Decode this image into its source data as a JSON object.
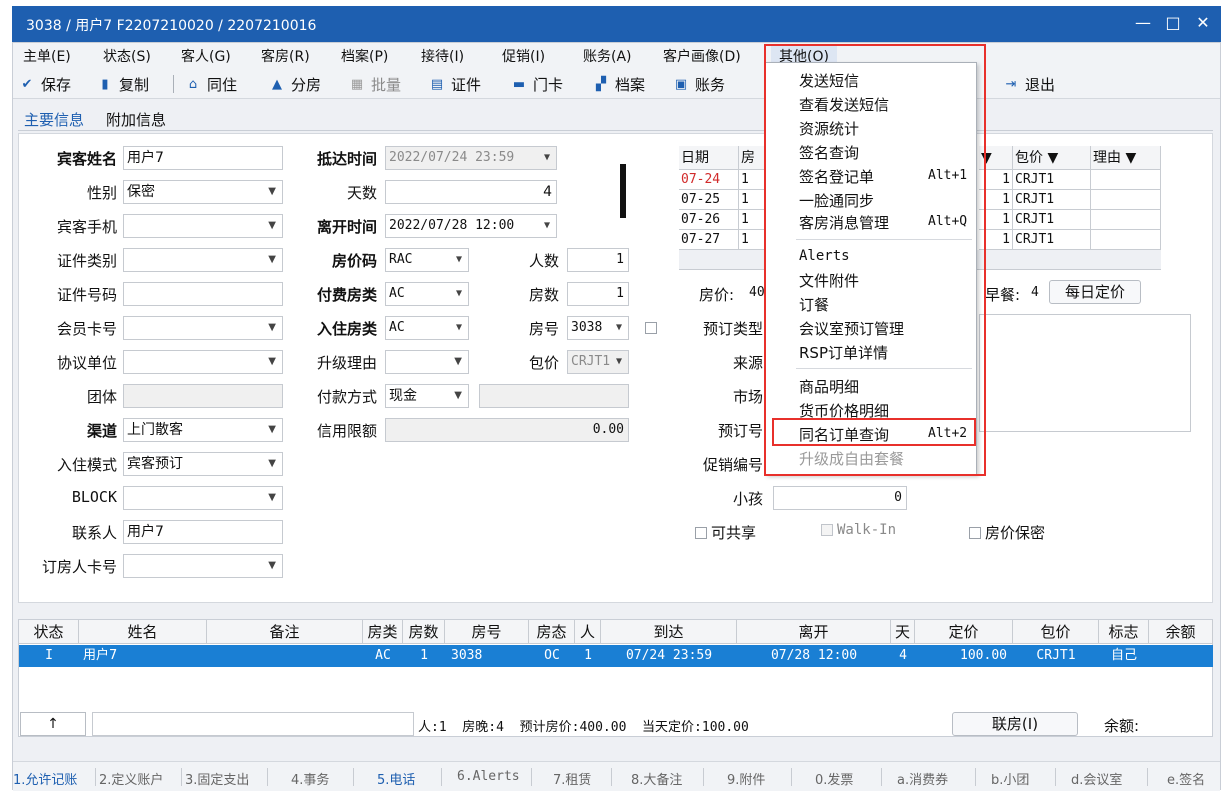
{
  "window": {
    "title": "3038 / 用户7 F2207210020 / 2207210016",
    "controls": [
      "—",
      "□",
      "✕"
    ]
  },
  "menubar": [
    {
      "label": "主单(E)"
    },
    {
      "label": "状态(S)"
    },
    {
      "label": "客人(G)"
    },
    {
      "label": "客房(R)"
    },
    {
      "label": "档案(P)"
    },
    {
      "label": "接待(I)"
    },
    {
      "label": "促销(I)"
    },
    {
      "label": "账务(A)"
    },
    {
      "label": "客户画像(D)"
    },
    {
      "label": "其他(O)"
    }
  ],
  "toolbar": [
    {
      "label": "保存",
      "icon": "check-circle-icon",
      "glyph": "✔"
    },
    {
      "label": "复制",
      "icon": "copy-icon",
      "glyph": "▮"
    },
    {
      "label": "同住",
      "icon": "house-icon",
      "glyph": "⌂"
    },
    {
      "label": "分房",
      "icon": "arrow-up-house-icon",
      "glyph": "▲"
    },
    {
      "label": "批量",
      "icon": "batch-icon",
      "glyph": "▦"
    },
    {
      "label": "证件",
      "icon": "id-card-icon",
      "glyph": "▤"
    },
    {
      "label": "门卡",
      "icon": "door-card-icon",
      "glyph": "▬"
    },
    {
      "label": "档案",
      "icon": "profile-icon",
      "glyph": "▞"
    },
    {
      "label": "账务",
      "icon": "ledger-icon",
      "glyph": "▣"
    },
    {
      "label": "退出",
      "icon": "exit-icon",
      "glyph": "⇥"
    }
  ],
  "tabs": [
    {
      "label": "主要信息"
    },
    {
      "label": "附加信息"
    }
  ],
  "form": {
    "guest_name_label": "宾客姓名",
    "guest_name": "用户7",
    "gender_label": "性别",
    "gender": "保密",
    "mobile_label": "宾客手机",
    "mobile": "",
    "id_type_label": "证件类别",
    "id_type": "",
    "id_number_label": "证件号码",
    "id_number": "",
    "member_card_label": "会员卡号",
    "member_card": "",
    "agreement_label": "协议单位",
    "agreement": "",
    "group_label": "团体",
    "group": "",
    "channel_label": "渠道",
    "channel": "上门散客",
    "checkin_mode_label": "入住模式",
    "checkin_mode": "宾客预订",
    "block_label": "BLOCK",
    "block": "",
    "contact_label": "联系人",
    "contact": "用户7",
    "booker_card_label": "订房人卡号",
    "booker_card": "",
    "arrival_label": "抵达时间",
    "arrival": "2022/07/24 23:59",
    "days_label": "天数",
    "days": "4",
    "departure_label": "离开时间",
    "departure": "2022/07/28 12:00",
    "rate_code_label": "房价码",
    "rate_code": "RAC",
    "pay_room_type_label": "付费房类",
    "pay_room_type": "AC",
    "checkin_room_type_label": "入住房类",
    "checkin_room_type": "AC",
    "upgrade_reason_label": "升级理由",
    "upgrade_reason": "",
    "payment_method_label": "付款方式",
    "payment_method": "现金",
    "payment_extra": "",
    "credit_limit_label": "信用限额",
    "credit_limit": "0.00",
    "persons_label": "人数",
    "persons": "1",
    "rooms_label": "房数",
    "rooms": "1",
    "room_no_label": "房号",
    "room_no": "3038",
    "package_label": "包价",
    "package": "CRJT1",
    "reserve_type_label": "预订类型",
    "source_label": "来源",
    "market_label": "市场",
    "reserve_no_label": "预订号",
    "promo_no_label": "促销编号",
    "children_label": "小孩",
    "children": "0",
    "shareable_label": "可共享",
    "walkin_label": "Walk-In",
    "rate_secret_label": "房价保密",
    "room_price_label": "房价:",
    "room_price_value": "40",
    "breakfast_label": "早餐:",
    "breakfast_value": "4",
    "daily_rate_button": "每日定价"
  },
  "rate_grid": {
    "headers": [
      "日期",
      "房",
      "▼",
      "包价 ▼",
      "理由 ▼"
    ],
    "rows": [
      {
        "date": "07-24",
        "room": "1",
        "count": "1",
        "package": "CRJT1",
        "reason": ""
      },
      {
        "date": "07-25",
        "room": "1",
        "count": "1",
        "package": "CRJT1",
        "reason": ""
      },
      {
        "date": "07-26",
        "room": "1",
        "count": "1",
        "package": "CRJT1",
        "reason": ""
      },
      {
        "date": "07-27",
        "room": "1",
        "count": "1",
        "package": "CRJT1",
        "reason": ""
      }
    ]
  },
  "list": {
    "headers": [
      "状态",
      "姓名",
      "备注",
      "房类",
      "房数",
      "房号",
      "房态",
      "人",
      "到达",
      "离开",
      "天",
      "定价",
      "包价",
      "标志",
      "余额"
    ],
    "rows": [
      {
        "status": "I",
        "name": "用户7",
        "note": "",
        "room_type": "AC",
        "rooms": "1",
        "room_no": "3038",
        "room_state": "OC",
        "persons": "1",
        "arrival": "07/24 23:59",
        "departure": "07/28 12:00",
        "days": "4",
        "rate": "100.00",
        "package": "CRJT1",
        "flag": "自己",
        "balance": ""
      }
    ]
  },
  "summary": {
    "up_button": "↑",
    "search_value": "",
    "text": "人:1  房晚:4  预计房价:400.00  当天定价:100.00",
    "join_button": "联房(I)",
    "balance_label": "余额:"
  },
  "bottombar": [
    {
      "label": "1.允许记账",
      "active": true
    },
    {
      "label": "2.定义账户"
    },
    {
      "label": "3.固定支出"
    },
    {
      "label": "4.事务"
    },
    {
      "label": "5.电话",
      "active": true
    },
    {
      "label": "6.Alerts"
    },
    {
      "label": "7.租赁"
    },
    {
      "label": "8.大备注"
    },
    {
      "label": "9.附件"
    },
    {
      "label": "0.发票"
    },
    {
      "label": "a.消费券"
    },
    {
      "label": "b.小团"
    },
    {
      "label": "d.会议室"
    },
    {
      "label": "e.签名"
    }
  ],
  "dropdown": {
    "items": [
      {
        "label": "发送短信"
      },
      {
        "label": "查看发送短信"
      },
      {
        "label": "资源统计"
      },
      {
        "label": "签名查询"
      },
      {
        "label": "签名登记单",
        "shortcut": "Alt+1"
      },
      {
        "label": "一脸通同步"
      },
      {
        "label": "客房消息管理",
        "shortcut": "Alt+Q"
      },
      {
        "label": "Alerts"
      },
      {
        "label": "文件附件"
      },
      {
        "label": "订餐"
      },
      {
        "label": "会议室预订管理"
      },
      {
        "label": "RSP订单详情"
      },
      {
        "label": "商品明细"
      },
      {
        "label": "货币价格明细"
      },
      {
        "label": "同名订单查询",
        "shortcut": "Alt+2"
      },
      {
        "label": "升级成自由套餐"
      }
    ]
  },
  "colors": {
    "title_bar": "#1e5fb0",
    "selected_row": "#1a7fd4",
    "highlight_box": "#e8302b",
    "active_tab_text": "#1e5fb0"
  }
}
